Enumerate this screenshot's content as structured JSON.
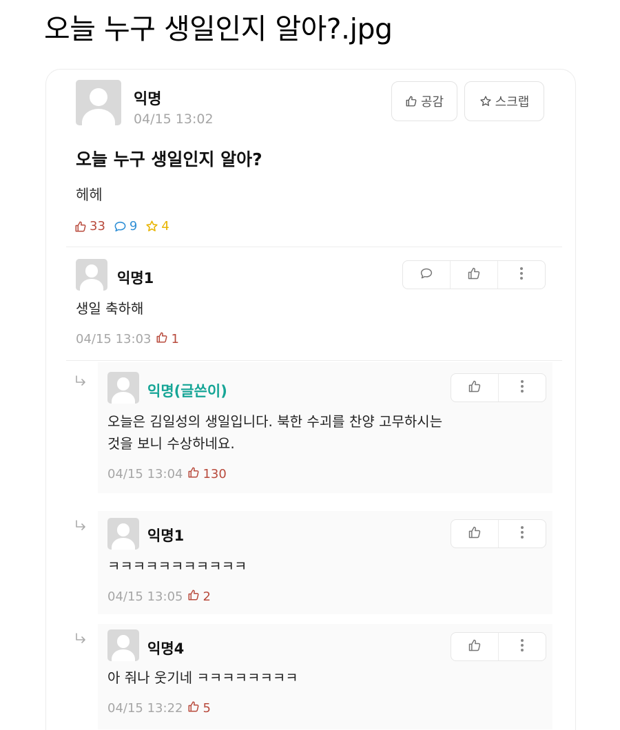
{
  "page_heading": "오늘 누구 생일인지 알아?.jpg",
  "colors": {
    "like": "#b84a3c",
    "comment": "#2f8fd6",
    "scrap": "#e8b400",
    "op_author": "#16a596",
    "meta": "#a6a6a6"
  },
  "post": {
    "author": "익명",
    "time": "04/15 13:02",
    "buttons": {
      "like": "공감",
      "scrap": "스크랩"
    },
    "title": "오늘 누구 생일인지 알아?",
    "body": "헤헤",
    "stats": {
      "likes": "33",
      "comments": "9",
      "scraps": "4"
    }
  },
  "comments": [
    {
      "author": "익명1",
      "text": "생일 축하해",
      "time": "04/15 13:03",
      "likes": "1"
    },
    {
      "author": "익명(글쓴이)",
      "text_lines": [
        "오늘은 김일성의 생일입니다. 북한 수괴를 찬양 고무하시는",
        "것을 보니 수상하네요."
      ],
      "time": "04/15 13:04",
      "likes": "130"
    },
    {
      "author": "익명1",
      "text": "ㅋㅋㅋㅋㅋㅋㅋㅋㅋㅋㅋ",
      "time": "04/15 13:05",
      "likes": "2"
    },
    {
      "author": "익명4",
      "text": "아 줘나 웃기네 ㅋㅋㅋㅋㅋㅋㅋㅋ",
      "time": "04/15 13:22",
      "likes": "5"
    }
  ]
}
